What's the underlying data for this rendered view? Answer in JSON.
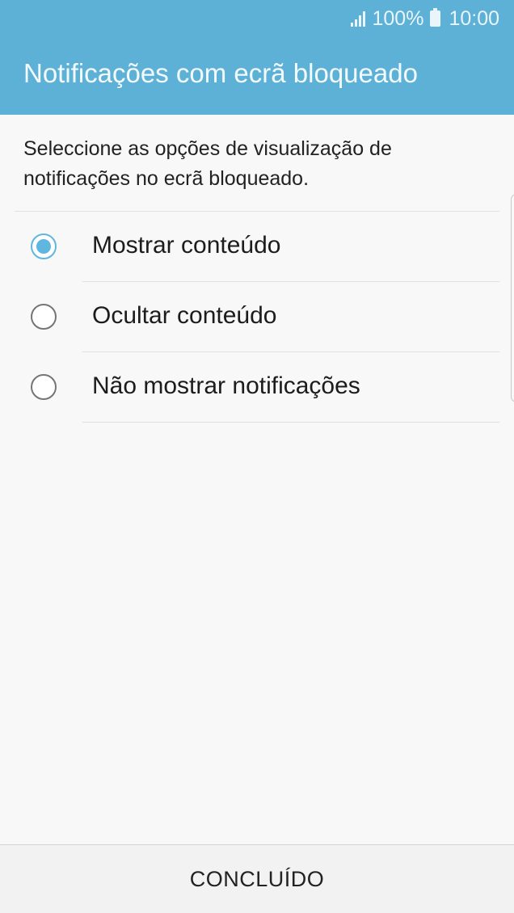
{
  "status_bar": {
    "battery": "100%",
    "time": "10:00",
    "icons": [
      "signal-icon",
      "battery-icon"
    ]
  },
  "header": {
    "title": "Notificações com ecrã bloqueado"
  },
  "description": "Seleccione as opções de visualização de notificações no ecrã bloqueado.",
  "options": [
    {
      "label": "Mostrar conteúdo",
      "selected": true
    },
    {
      "label": "Ocultar conteúdo",
      "selected": false
    },
    {
      "label": "Não mostrar notificações",
      "selected": false
    }
  ],
  "footer": {
    "done_label": "CONCLUÍDO"
  },
  "colors": {
    "header_background": "#5db1d6",
    "accent": "#5fb6df",
    "page_background": "#f8f8f8"
  }
}
